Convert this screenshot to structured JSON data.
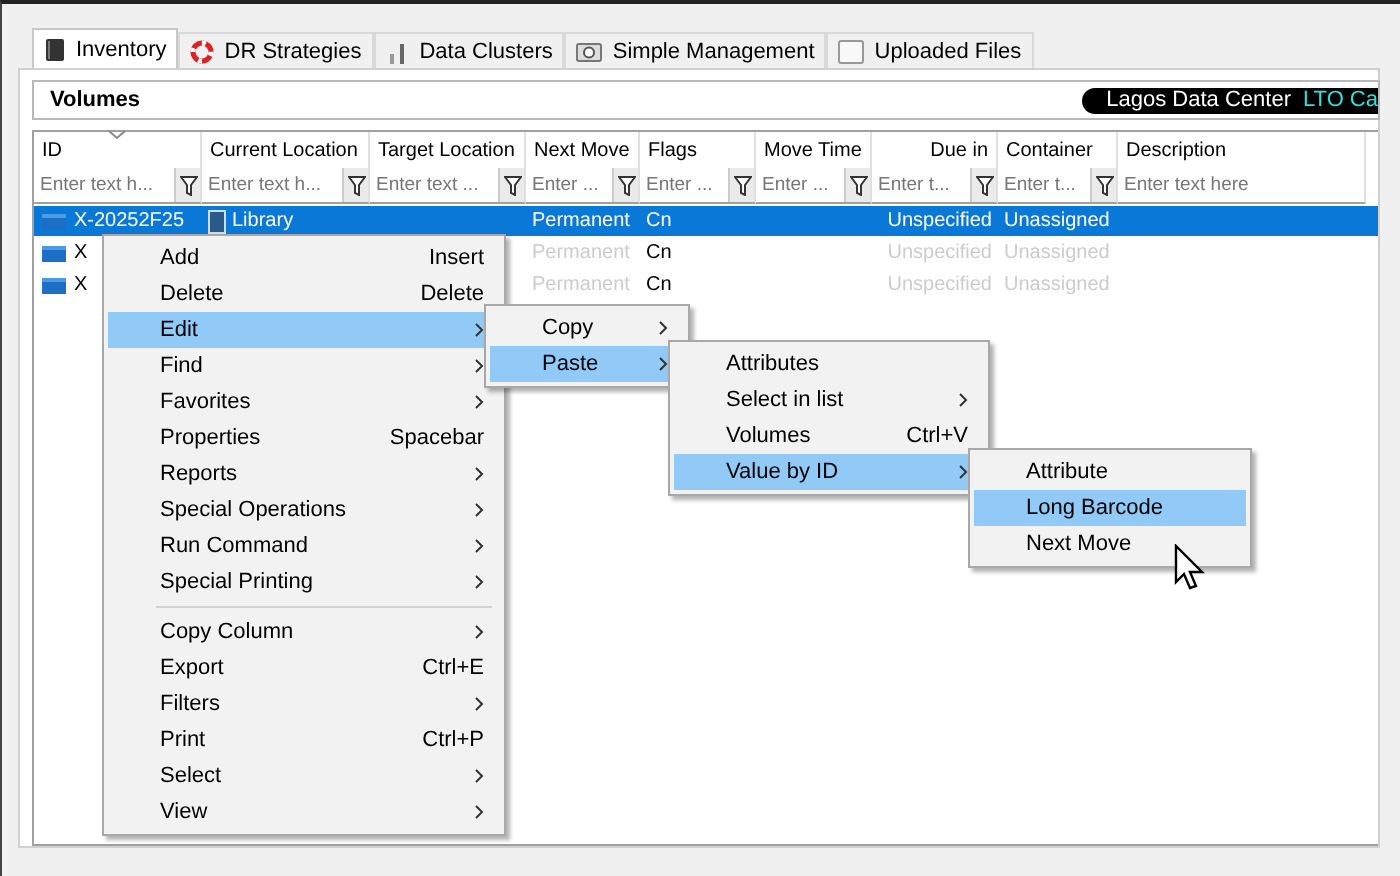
{
  "tabs": [
    {
      "label": "Inventory",
      "selected": true
    },
    {
      "label": "DR Strategies",
      "selected": false
    },
    {
      "label": "Data Clusters",
      "selected": false
    },
    {
      "label": "Simple Management",
      "selected": false
    },
    {
      "label": "Uploaded Files",
      "selected": false
    }
  ],
  "panel": {
    "title": "Volumes",
    "location": "Lagos Data Center",
    "media": "LTO Ca"
  },
  "table": {
    "columns": [
      {
        "label": "ID",
        "placeholder": "Enter text h...",
        "filter": true,
        "sorted": true
      },
      {
        "label": "Current Location",
        "placeholder": "Enter text h...",
        "filter": true,
        "sorted": false
      },
      {
        "label": "Target Location",
        "placeholder": "Enter text ...",
        "filter": true,
        "sorted": false
      },
      {
        "label": "Next Move",
        "placeholder": "Enter ...",
        "filter": true,
        "sorted": false
      },
      {
        "label": "Flags",
        "placeholder": "Enter ...",
        "filter": true,
        "sorted": false
      },
      {
        "label": "Move Time",
        "placeholder": "Enter ...",
        "filter": true,
        "sorted": false
      },
      {
        "label": "Due in",
        "placeholder": "Enter t...",
        "filter": true,
        "sorted": false
      },
      {
        "label": "Container",
        "placeholder": "Enter t...",
        "filter": true,
        "sorted": false
      },
      {
        "label": "Description",
        "placeholder": "Enter text here",
        "filter": false,
        "sorted": false
      }
    ],
    "rows": [
      {
        "selected": true,
        "dimmed": false,
        "cells": [
          "X-20252F25",
          "Library",
          "",
          "Permanent",
          "Cn",
          "",
          "Unspecified",
          "Unassigned",
          ""
        ]
      },
      {
        "selected": false,
        "dimmed": true,
        "cells": [
          "X",
          "",
          "",
          "Permanent",
          "Cn",
          "",
          "Unspecified",
          "Unassigned",
          ""
        ]
      },
      {
        "selected": false,
        "dimmed": true,
        "cells": [
          "X",
          "",
          "",
          "Permanent",
          "Cn",
          "",
          "Unspecified",
          "Unassigned",
          ""
        ]
      }
    ]
  },
  "menus": [
    {
      "items": [
        {
          "kind": "item",
          "label": "Add",
          "shortcut": "Insert",
          "submenu": false,
          "selected": false
        },
        {
          "kind": "item",
          "label": "Delete",
          "shortcut": "Delete",
          "submenu": false,
          "selected": false
        },
        {
          "kind": "item",
          "label": "Edit",
          "submenu": true,
          "selected": true
        },
        {
          "kind": "item",
          "label": "Find",
          "submenu": true,
          "selected": false
        },
        {
          "kind": "item",
          "label": "Favorites",
          "submenu": true,
          "selected": false
        },
        {
          "kind": "item",
          "label": "Properties",
          "shortcut": "Spacebar",
          "submenu": false,
          "selected": false
        },
        {
          "kind": "item",
          "label": "Reports",
          "submenu": true,
          "selected": false
        },
        {
          "kind": "item",
          "label": "Special Operations",
          "submenu": true,
          "selected": false
        },
        {
          "kind": "item",
          "label": "Run Command",
          "submenu": true,
          "selected": false
        },
        {
          "kind": "item",
          "label": "Special Printing",
          "submenu": true,
          "selected": false
        },
        {
          "kind": "separator"
        },
        {
          "kind": "item",
          "label": "Copy Column",
          "submenu": true,
          "selected": false
        },
        {
          "kind": "item",
          "label": "Export",
          "shortcut": "Ctrl+E",
          "submenu": false,
          "selected": false
        },
        {
          "kind": "item",
          "label": "Filters",
          "submenu": true,
          "selected": false
        },
        {
          "kind": "item",
          "label": "Print",
          "shortcut": "Ctrl+P",
          "submenu": false,
          "selected": false
        },
        {
          "kind": "item",
          "label": "Select",
          "submenu": true,
          "selected": false
        },
        {
          "kind": "item",
          "label": "View",
          "submenu": true,
          "selected": false
        }
      ]
    },
    {
      "items": [
        {
          "kind": "item",
          "label": "Copy",
          "submenu": true,
          "selected": false
        },
        {
          "kind": "item",
          "label": "Paste",
          "submenu": true,
          "selected": true
        }
      ]
    },
    {
      "items": [
        {
          "kind": "item",
          "label": "Attributes",
          "submenu": false,
          "selected": false
        },
        {
          "kind": "item",
          "label": "Select in list",
          "submenu": true,
          "selected": false
        },
        {
          "kind": "item",
          "label": "Volumes",
          "shortcut": "Ctrl+V",
          "submenu": false,
          "selected": false
        },
        {
          "kind": "item",
          "label": "Value by ID",
          "submenu": true,
          "selected": true
        }
      ]
    },
    {
      "items": [
        {
          "kind": "item",
          "label": "Attribute",
          "submenu": false,
          "selected": false
        },
        {
          "kind": "item",
          "label": "Long Barcode",
          "submenu": false,
          "selected": true
        },
        {
          "kind": "item",
          "label": "Next Move",
          "submenu": false,
          "selected": false
        }
      ]
    }
  ]
}
